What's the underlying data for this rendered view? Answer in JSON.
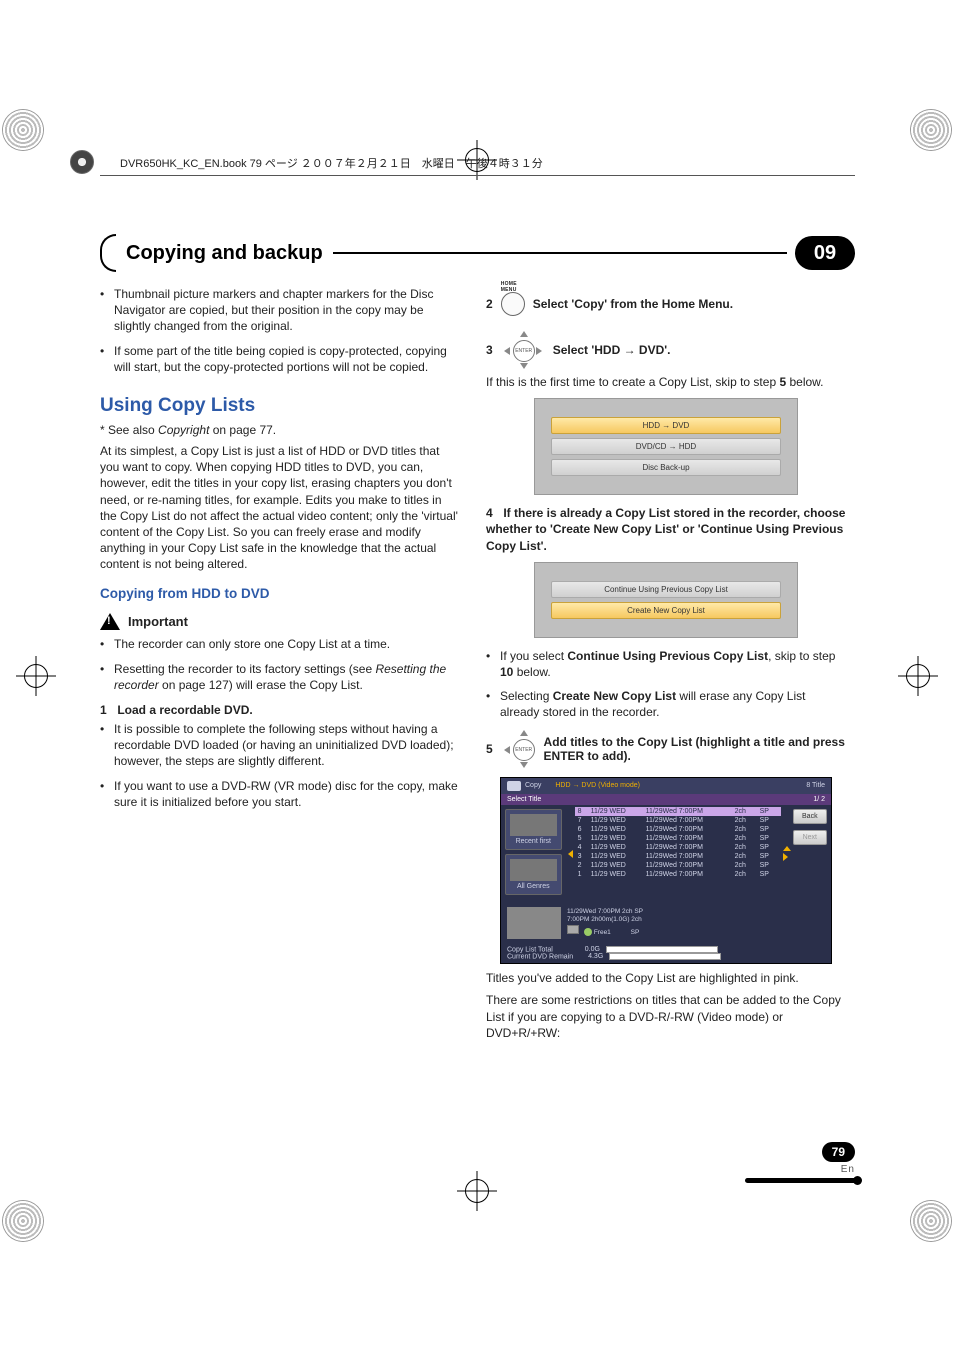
{
  "top_line": "DVR650HK_KC_EN.book  79 ページ  ２００７年２月２１日　水曜日　午後４時３１分",
  "header": {
    "title": "Copying and backup",
    "chapter": "09"
  },
  "left": {
    "intro_bullets": [
      "Thumbnail picture markers and chapter markers for the Disc Navigator are copied, but their position in the copy may be slightly changed from the original.",
      "If some part of the title being copied is copy-protected, copying will start, but the copy-protected portions will not be copied."
    ],
    "h2": "Using Copy Lists",
    "see_also_prefix": "* See also ",
    "see_also_emph": "Copyright",
    "see_also_suffix": " on page 77.",
    "body": "At its simplest, a Copy List is just a list of HDD or DVD titles that you want to copy. When copying HDD titles to DVD, you can, however, edit the titles in your copy list, erasing chapters you don't need, or re-naming titles, for example. Edits you make to titles in the Copy List do not affect the actual video content; only the 'virtual' content of the Copy List. So you can freely erase and modify anything in your Copy List safe in the knowledge that the actual content is not being altered.",
    "subhead": "Copying from HDD to DVD",
    "important_label": "Important",
    "important_bullets": [
      "The recorder can only store one Copy List at a time.",
      {
        "pre": "Resetting the recorder to its factory settings (see ",
        "em": "Resetting the recorder",
        "post": " on page 127) will erase the Copy List."
      }
    ],
    "step1_num": "1",
    "step1_text": "Load a recordable DVD.",
    "step1_bullets": [
      "It is possible to complete the following steps without having a recordable DVD loaded (or having an uninitialized DVD loaded); however, the steps are slightly different.",
      "If you want to use a DVD-RW (VR mode) disc for the copy, make sure it is initialized before you start."
    ]
  },
  "right": {
    "step2_num": "2",
    "home_icon_label": "HOME MENU",
    "step2_text": "Select 'Copy' from the Home Menu.",
    "step3_num": "3",
    "enter_label": "ENTER",
    "step3_text": "Select 'HDD → DVD'.",
    "step3_note_a": "If this is the first time to create a Copy List, skip to step ",
    "step3_note_b": "5",
    "step3_note_c": " below.",
    "menu1": {
      "rows": [
        "HDD → DVD",
        "DVD/CD → HDD",
        "Disc Back-up"
      ],
      "selected_index": 0
    },
    "step4_num": "4",
    "step4_text": "If there is already a Copy List stored in the recorder, choose whether to 'Create New Copy List' or 'Continue Using Previous Copy List'.",
    "menu2": {
      "rows": [
        "Continue Using Previous Copy List",
        "Create New Copy List"
      ],
      "selected_index": 1
    },
    "after_menu_bullets": [
      {
        "a": "If you select ",
        "b": "Continue Using Previous Copy List",
        "c": ", skip to step ",
        "d": "10",
        "e": " below."
      },
      {
        "a": "Selecting ",
        "b": "Create New Copy List",
        "c": " will erase any Copy List already stored in the recorder."
      }
    ],
    "step5_num": "5",
    "step5_text": "Add titles to the Copy List (highlight a title and press ENTER to add).",
    "shot": {
      "title": "Copy",
      "mode": "HDD → DVD (Video mode)",
      "count_label": "8 Title",
      "subbar": "Select Title",
      "subbar_right": "1/ 2",
      "left_panels": [
        {
          "label": "Recent first"
        },
        {
          "label": "All Genres"
        }
      ],
      "columns_example_row": [
        "n",
        "date",
        "datetime",
        "ch",
        "mode"
      ],
      "rows": [
        {
          "n": "8",
          "date": "11/29 WED",
          "dt": "11/29Wed 7:00PM",
          "ch": "2ch",
          "mode": "SP",
          "sel": true
        },
        {
          "n": "7",
          "date": "11/29 WED",
          "dt": "11/29Wed 7:00PM",
          "ch": "2ch",
          "mode": "SP"
        },
        {
          "n": "6",
          "date": "11/29 WED",
          "dt": "11/29Wed 7:00PM",
          "ch": "2ch",
          "mode": "SP"
        },
        {
          "n": "5",
          "date": "11/29 WED",
          "dt": "11/29Wed 7:00PM",
          "ch": "2ch",
          "mode": "SP"
        },
        {
          "n": "4",
          "date": "11/29 WED",
          "dt": "11/29Wed 7:00PM",
          "ch": "2ch",
          "mode": "SP"
        },
        {
          "n": "3",
          "date": "11/29 WED",
          "dt": "11/29Wed 7:00PM",
          "ch": "2ch",
          "mode": "SP"
        },
        {
          "n": "2",
          "date": "11/29 WED",
          "dt": "11/29Wed 7:00PM",
          "ch": "2ch",
          "mode": "SP"
        },
        {
          "n": "1",
          "date": "11/29 WED",
          "dt": "11/29Wed 7:00PM",
          "ch": "2ch",
          "mode": "SP"
        }
      ],
      "right_buttons": [
        {
          "label": "Back",
          "disabled": false
        },
        {
          "label": "Next",
          "disabled": true
        }
      ],
      "detail": {
        "l1": "11/29Wed 7:00PM   2ch   SP",
        "l2": "7:00PM       2h00m(1.0G)  2ch",
        "l3_icon": "Free1",
        "l3_mode": "SP"
      },
      "footer": {
        "copy_total_label": "Copy List Total",
        "copy_total_val": "0.0G",
        "remain_label": "Current DVD Remain",
        "remain_val": "4.3G"
      }
    },
    "after_shot_p1": "Titles you've added to the Copy List are highlighted in pink.",
    "after_shot_p2": "There are some restrictions on titles that can be added to the Copy List if you are copying to a DVD-R/-RW (Video mode) or DVD+R/+RW:"
  },
  "page": {
    "num": "79",
    "lang": "En"
  }
}
